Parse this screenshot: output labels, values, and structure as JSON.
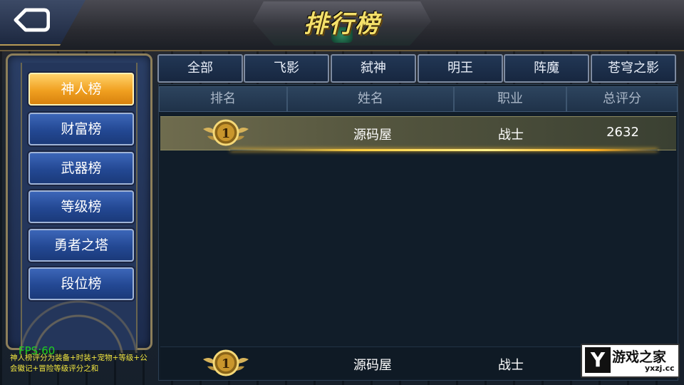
{
  "header": {
    "title": "排行榜"
  },
  "sidebar": {
    "items": [
      {
        "label": "神人榜"
      },
      {
        "label": "财富榜"
      },
      {
        "label": "武器榜"
      },
      {
        "label": "等级榜"
      },
      {
        "label": "勇者之塔"
      },
      {
        "label": "段位榜"
      }
    ],
    "active_index": 0
  },
  "tabs": [
    {
      "label": "全部"
    },
    {
      "label": "飞影"
    },
    {
      "label": "弑神"
    },
    {
      "label": "明王"
    },
    {
      "label": "阵魔"
    },
    {
      "label": "苍穹之影"
    }
  ],
  "table": {
    "columns": [
      "排名",
      "姓名",
      "职业",
      "总评分"
    ],
    "rows": [
      {
        "rank": "1",
        "name": "源码屋",
        "class": "战士",
        "score": "2632"
      }
    ],
    "my_rank": {
      "rank": "1",
      "name": "源码屋",
      "class": "战士"
    }
  },
  "status": {
    "fps": "FPS:60",
    "tip": "神人榜评分为装备+时装+宠物+等级+公会徽记+冒险等级评分之和"
  },
  "watermark": {
    "site_name": "游戏之家",
    "site_url": "yxzj.cc"
  },
  "colors": {
    "active_tab": "#f0a020",
    "button_blue": "#234893",
    "fps_green": "#1fd11f",
    "tip_yellow": "#f2e640"
  }
}
